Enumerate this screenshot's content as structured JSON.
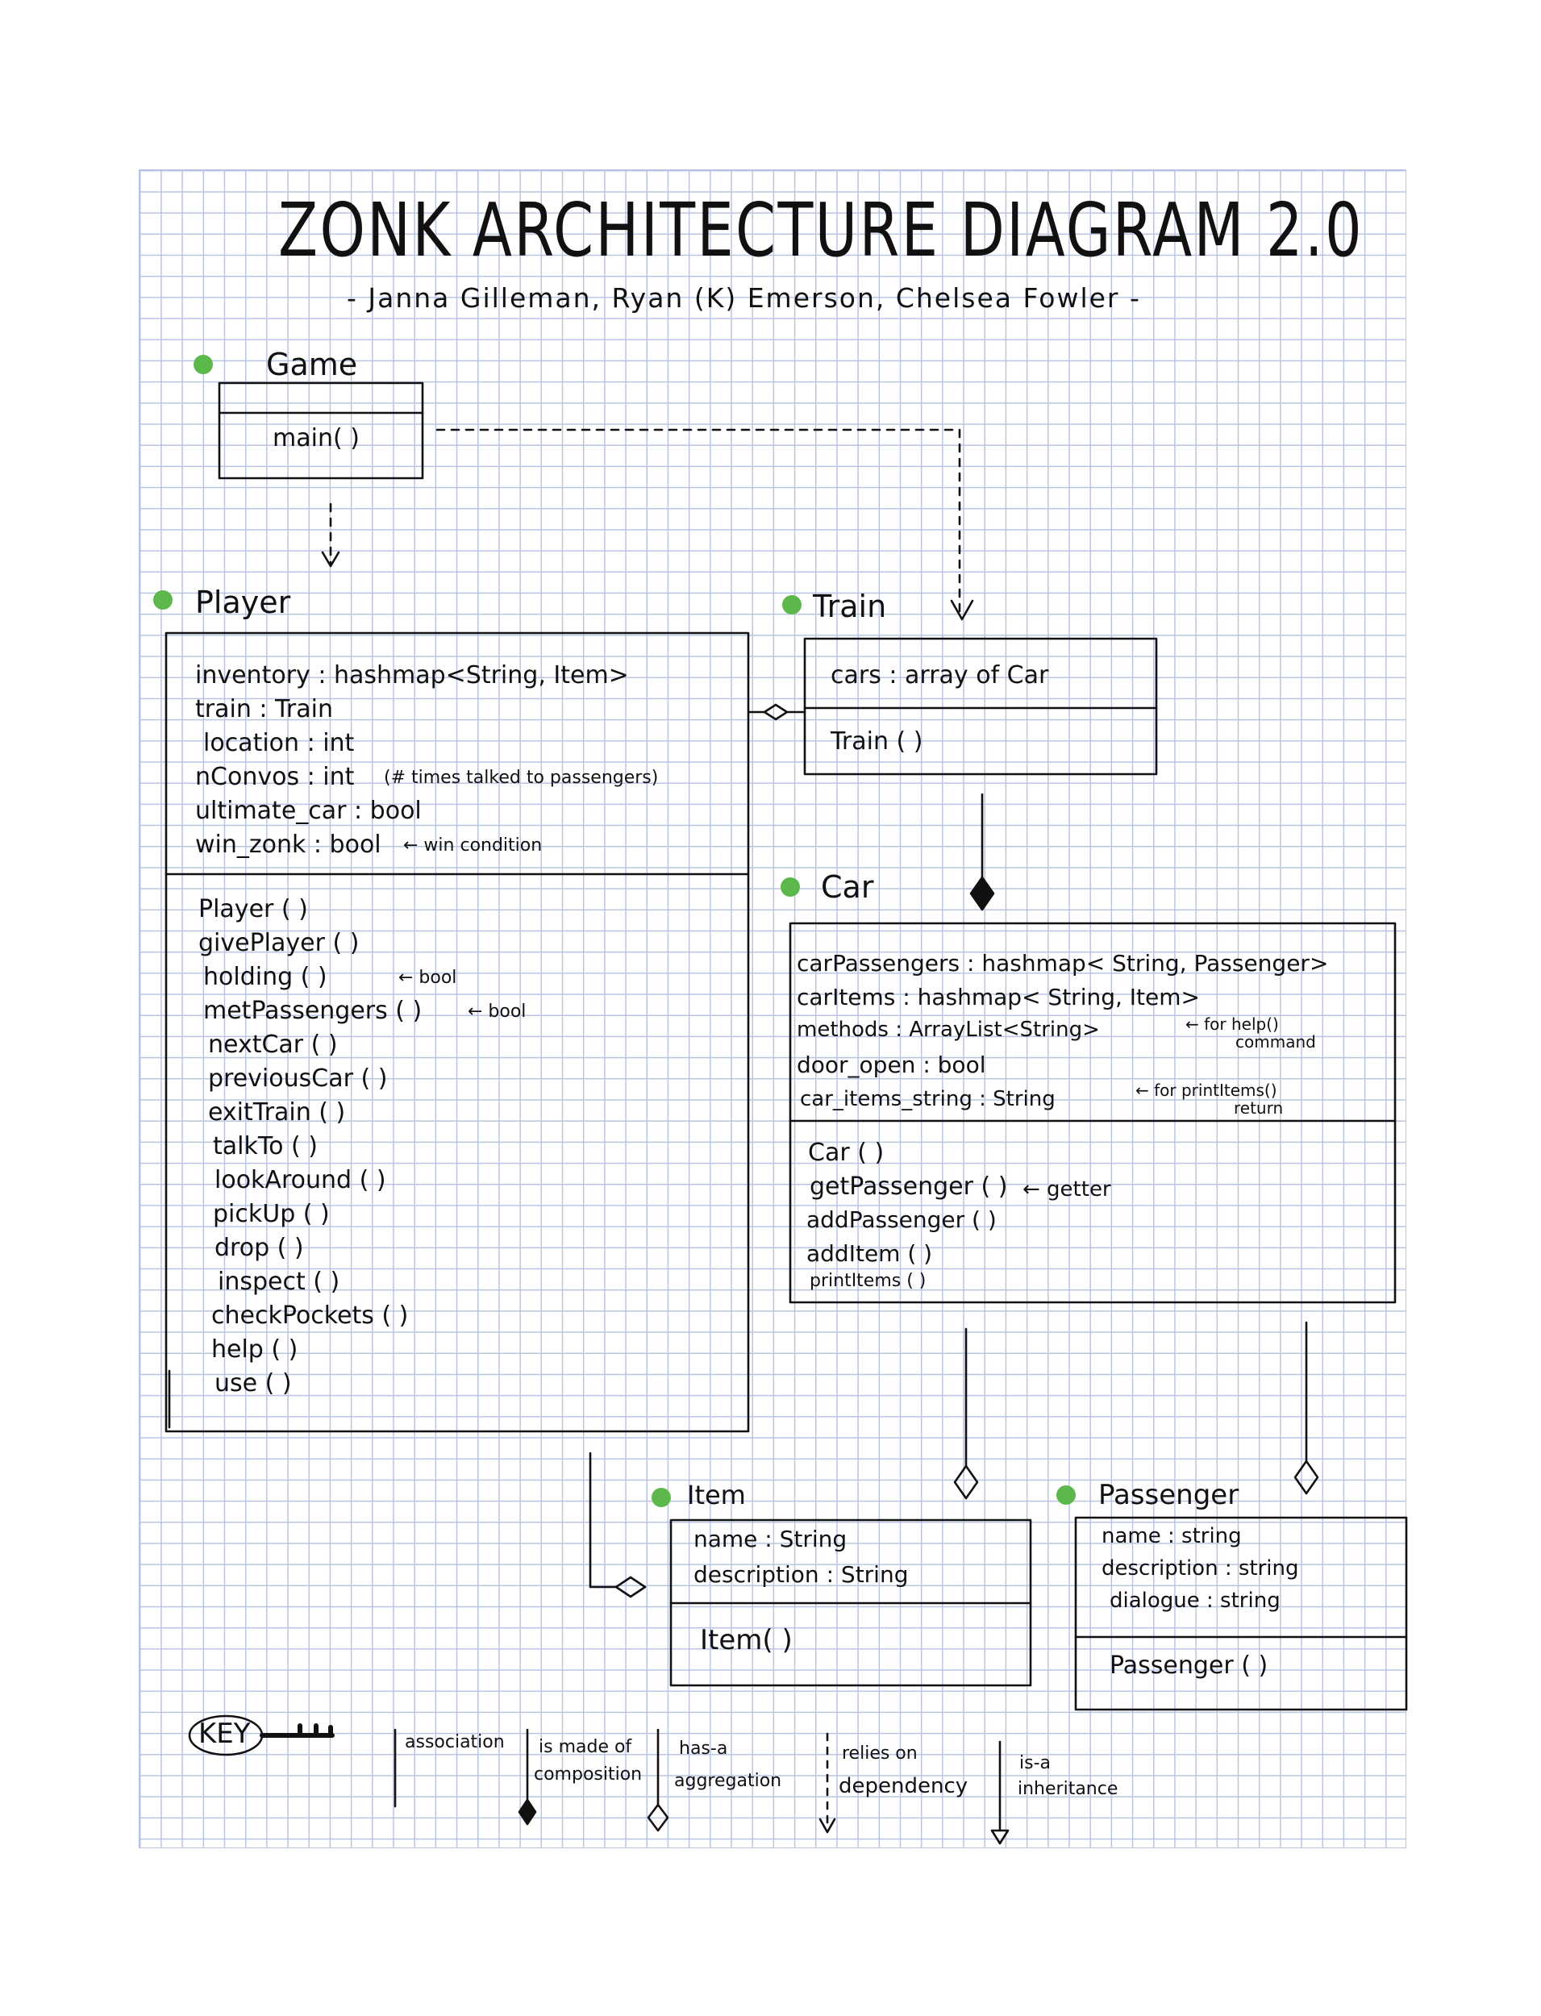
{
  "title": "ZONK ARCHITECTURE DIAGRAM 2.0",
  "authors": "- Janna Gilleman, Ryan (K) Emerson, Chelsea Fowler -",
  "colors": {
    "accent": "#5cb84a",
    "grid": "#b9c4e4",
    "ink": "#111111"
  },
  "classes": {
    "game": {
      "name": "Game",
      "attributes": [],
      "methods": [
        "main( )"
      ]
    },
    "player": {
      "name": "Player",
      "attributes": [
        "inventory : hashmap<String, Item>",
        "train : Train",
        "location : int",
        "nConvos : int",
        "ultimate_car : bool",
        "win_zonk : bool"
      ],
      "attribute_notes": {
        "nConvos": "(# times talked to passengers)",
        "win_zonk": "← win condition"
      },
      "methods": [
        "Player ( )",
        "givePlayer ( )",
        "holding ( )",
        "metPassengers ( )",
        "nextCar ( )",
        "previousCar ( )",
        "exitTrain ( )",
        "talkTo ( )",
        "lookAround ( )",
        "pickUp ( )",
        "drop ( )",
        "inspect ( )",
        "checkPockets ( )",
        "help ( )",
        "use ( )"
      ],
      "method_notes": {
        "holding": "← bool",
        "metPassengers": "← bool"
      }
    },
    "train": {
      "name": "Train",
      "attributes": [
        "cars : array of Car"
      ],
      "methods": [
        "Train ( )"
      ]
    },
    "car": {
      "name": "Car",
      "attributes": [
        "carPassengers : hashmap< String, Passenger>",
        "carItems : hashmap< String, Item>",
        "methods : ArrayList<String>",
        "door_open : bool",
        "car_items_string : String"
      ],
      "attribute_notes": {
        "methods_line1": "← for help()",
        "methods_line2": "command",
        "items_line1": "← for printItems()",
        "items_line2": "return"
      },
      "methods": [
        "Car ( )",
        "getPassenger ( )",
        "addPassenger ( )",
        "addItem ( )",
        "printItems ( )"
      ],
      "method_notes": {
        "getPassenger": "← getter"
      }
    },
    "item": {
      "name": "Item",
      "attributes": [
        "name : String",
        "description : String"
      ],
      "methods": [
        "Item( )"
      ]
    },
    "passenger": {
      "name": "Passenger",
      "attributes": [
        "name : string",
        "description : string",
        "dialogue : string"
      ],
      "methods": [
        "Passenger ( )"
      ]
    }
  },
  "key": {
    "label": "KEY",
    "items": [
      {
        "label_line1": "association",
        "label_line2": ""
      },
      {
        "label_line1": "is made of",
        "label_line2": "composition"
      },
      {
        "label_line1": "has-a",
        "label_line2": "aggregation"
      },
      {
        "label_line1": "relies on",
        "label_line2": "dependency"
      },
      {
        "label_line1": "is-a",
        "label_line2": "inheritance"
      }
    ]
  }
}
